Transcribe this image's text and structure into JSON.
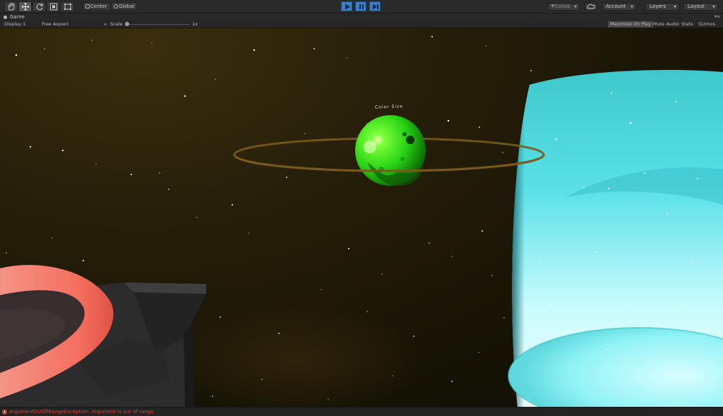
{
  "toolbar": {
    "pivot_center": "Center",
    "pivot_global": "Global",
    "collab": "Collab",
    "account": "Account",
    "layers": "Layers",
    "layout": "Layout"
  },
  "game_tab": {
    "title": "Game",
    "menu_glyph": "▾≡"
  },
  "game_bar": {
    "display": "Display 1",
    "aspect": "Free Aspect",
    "scale_label": "Scale",
    "scale_value": "1x",
    "maximize_on_play": "Maximize On Play",
    "mute_audio": "Mute Audio",
    "stats": "Stats",
    "gizmos": "Gizmos"
  },
  "scene": {
    "planet_label": "Color Size"
  },
  "status": {
    "error_text": "ArgumentOutOfRangeException: Argument is out of range."
  },
  "colors": {
    "play_active": "#3c7fc7",
    "planet": "#35e01a",
    "ring": "#7a5a1c",
    "cyan_planet": "#7ff0f0",
    "red_ring": "#ff8a78",
    "error": "#d9463a"
  },
  "icons": [
    "hand-icon",
    "move-icon",
    "rotate-icon",
    "scale-icon",
    "rect-icon",
    "play-icon",
    "pause-icon",
    "step-icon",
    "cloud-icon",
    "error-icon"
  ]
}
